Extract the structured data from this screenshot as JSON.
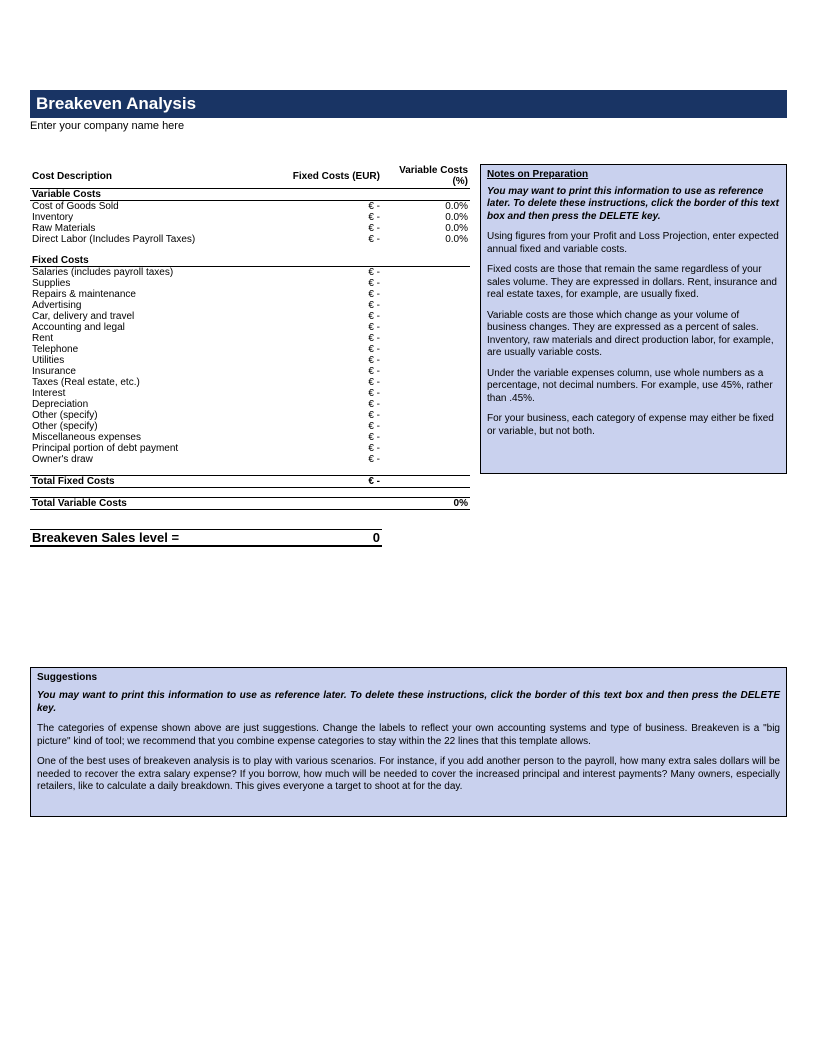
{
  "header": {
    "title": "Breakeven Analysis",
    "subtitle": "Enter your company name here"
  },
  "table": {
    "col_desc": "Cost Description",
    "col_fixed": "Fixed Costs (EUR)",
    "col_var": "Variable Costs (%)",
    "variable_section": "Variable Costs",
    "fixed_section": "Fixed Costs",
    "variable_rows": [
      {
        "label": "Cost of Goods Sold",
        "fixed": "€ -",
        "var": "0.0%"
      },
      {
        "label": "Inventory",
        "fixed": "€ -",
        "var": "0.0%"
      },
      {
        "label": "Raw Materials",
        "fixed": "€ -",
        "var": "0.0%"
      },
      {
        "label": "Direct Labor (Includes Payroll Taxes)",
        "fixed": "€ -",
        "var": "0.0%"
      }
    ],
    "fixed_rows": [
      {
        "label": "Salaries (includes payroll taxes)",
        "fixed": "€ -"
      },
      {
        "label": "Supplies",
        "fixed": "€ -"
      },
      {
        "label": "Repairs & maintenance",
        "fixed": "€ -"
      },
      {
        "label": "Advertising",
        "fixed": "€ -"
      },
      {
        "label": "Car, delivery and travel",
        "fixed": "€ -"
      },
      {
        "label": "Accounting and legal",
        "fixed": "€ -"
      },
      {
        "label": "Rent",
        "fixed": "€ -"
      },
      {
        "label": "Telephone",
        "fixed": "€ -"
      },
      {
        "label": "Utilities",
        "fixed": "€ -"
      },
      {
        "label": "Insurance",
        "fixed": "€ -"
      },
      {
        "label": "Taxes (Real estate, etc.)",
        "fixed": "€ -"
      },
      {
        "label": "Interest",
        "fixed": "€ -"
      },
      {
        "label": "Depreciation",
        "fixed": "€ -"
      },
      {
        "label": "Other (specify)",
        "fixed": "€ -"
      },
      {
        "label": "Other (specify)",
        "fixed": "€ -"
      },
      {
        "label": "Miscellaneous expenses",
        "fixed": "€ -"
      },
      {
        "label": "Principal portion of debt payment",
        "fixed": "€ -"
      },
      {
        "label": "Owner's draw",
        "fixed": "€ -"
      }
    ],
    "total_fixed_label": "Total Fixed Costs",
    "total_fixed_value": "€ -",
    "total_var_label": "Total Variable Costs",
    "total_var_value": "0%",
    "breakeven_label": "Breakeven Sales level  =",
    "breakeven_value": "0"
  },
  "notes": {
    "title": "Notes on Preparation",
    "lead": "You may want to print this information to use as reference later. To delete these instructions, click the border of this text box and then press the DELETE key.",
    "p2": "Using figures from your Profit and Loss Projection, enter expected annual fixed and variable costs.",
    "p3": "Fixed costs are those that remain the same regardless of your sales volume. They are expressed in dollars. Rent, insurance and real estate taxes, for example, are usually fixed.",
    "p4": "Variable costs are those which change as your volume of business changes. They are expressed as a percent of sales. Inventory, raw materials and direct production labor, for example, are usually variable costs.",
    "p5": "Under the variable expenses column, use whole numbers as a percentage, not decimal numbers. For example, use 45%, rather than .45%.",
    "p6": "For your business, each category of expense may either be fixed or variable, but not both."
  },
  "suggestions": {
    "title": "Suggestions",
    "lead": "You may want to print this information to use as reference later. To delete these instructions, click the border of this text box and then press the DELETE key.",
    "p2": "The categories of expense shown above are just suggestions. Change the labels to reflect your own accounting systems and type of business. Breakeven is a \"big picture\" kind of tool; we recommend that you combine expense categories to stay within the 22 lines that this template allows.",
    "p3": "One of the best uses of breakeven analysis is to play with various scenarios. For instance, if you add another person to the payroll, how many extra sales dollars will be needed to recover the extra salary expense? If you borrow, how much will be needed to cover the increased principal and interest payments? Many owners, especially retailers, like to calculate a daily breakdown. This gives everyone a target to shoot at for the day."
  }
}
